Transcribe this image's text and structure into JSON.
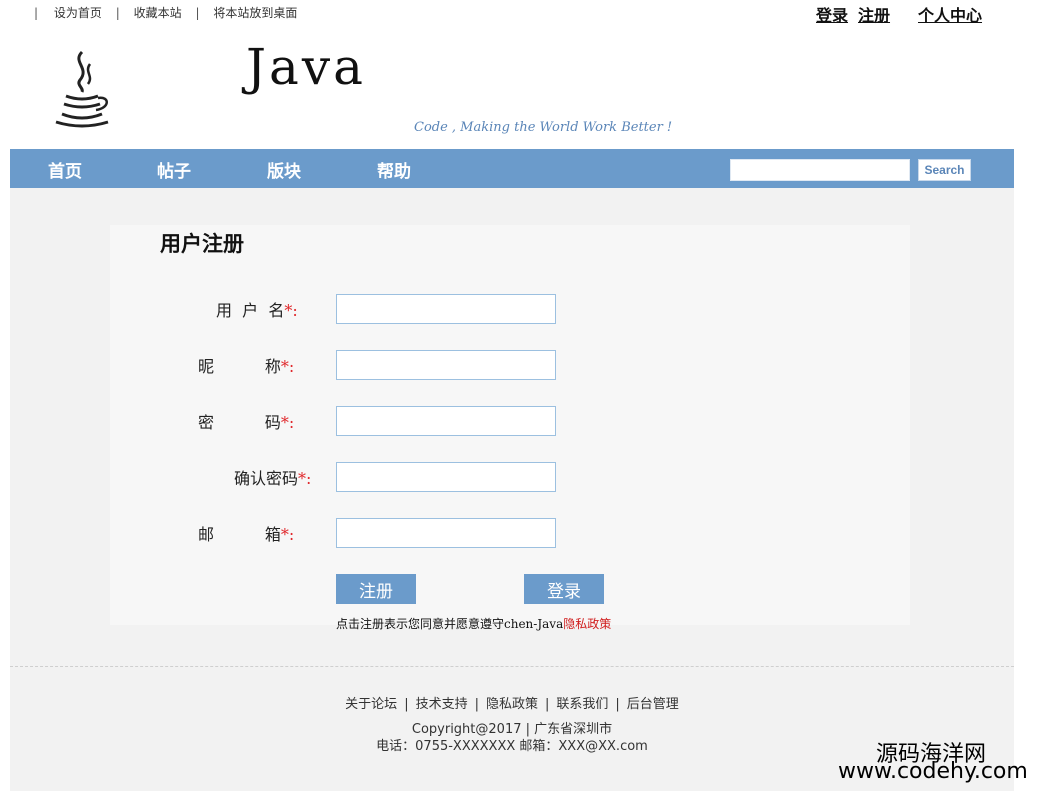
{
  "topbar": {
    "links": [
      "设为首页",
      "收藏本站",
      "将本站放到桌面"
    ],
    "separator": "|",
    "user_links": {
      "login": "登录",
      "register": "注册",
      "center": "个人中心"
    }
  },
  "banner": {
    "logo_text": "Java",
    "slogan": "Code , Making the World Work Better !"
  },
  "nav": {
    "items": [
      "首页",
      "帖子",
      "版块",
      "帮助"
    ],
    "search_button": "Search",
    "search_placeholder": ""
  },
  "form": {
    "title": "用户注册",
    "required_mark": "*:",
    "fields": [
      {
        "label": "用  户  名",
        "value": ""
      },
      {
        "label": "昵          称",
        "value": ""
      },
      {
        "label": "密          码",
        "value": ""
      },
      {
        "label": "确认密码",
        "value": ""
      },
      {
        "label": "邮          箱",
        "value": ""
      }
    ],
    "register_button": "注册",
    "login_button": "登录",
    "agreement_text": "点击注册表示您同意并愿意遵守chen-Java",
    "agreement_policy": "隐私政策"
  },
  "footer": {
    "links": [
      "关于论坛",
      "技术支持",
      "隐私政策",
      "联系我们",
      "后台管理"
    ],
    "copyright": "Copyright@2017 | 广东省深圳市",
    "contact": "电话：0755-XXXXXXX 邮箱：XXX@XX.com"
  },
  "watermark": {
    "line1": "源码海洋网",
    "line2": "www.codehy.com"
  },
  "colors": {
    "nav_bg": "#6b9bcb",
    "required": "#e0262a",
    "policy": "#d01d1d"
  }
}
